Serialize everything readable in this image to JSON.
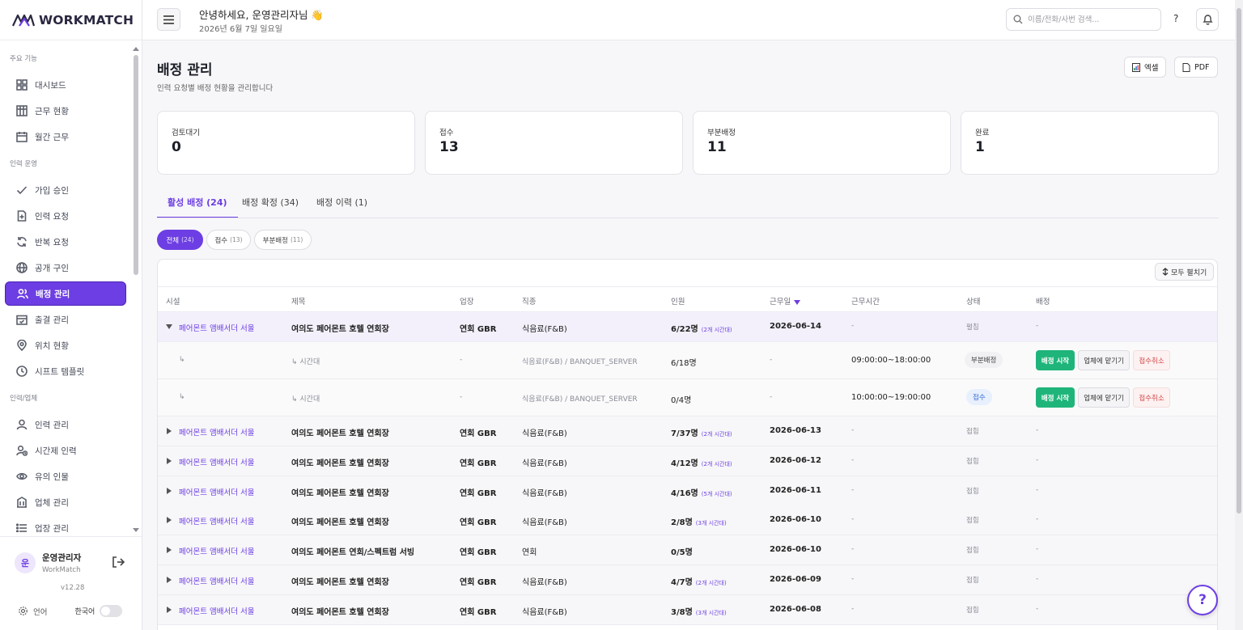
{
  "brand": {
    "name": "WORKMATCH",
    "accent": "#6d3ee3"
  },
  "sidebar": {
    "sections": [
      {
        "title": "주요 기능",
        "items": [
          {
            "label": "대시보드",
            "icon": "grid-icon"
          },
          {
            "label": "근무 현황",
            "icon": "table-icon"
          },
          {
            "label": "월간 근무",
            "icon": "calendar-icon"
          }
        ]
      },
      {
        "title": "인력 운영",
        "items": [
          {
            "label": "가입 승인",
            "icon": "check-icon"
          },
          {
            "label": "인력 요청",
            "icon": "file-plus-icon"
          },
          {
            "label": "반복 요청",
            "icon": "refresh-icon"
          },
          {
            "label": "공개 구인",
            "icon": "globe-icon"
          },
          {
            "label": "배정 관리",
            "icon": "users-icon",
            "active": true
          },
          {
            "label": "출결 관리",
            "icon": "calendar-check-icon"
          },
          {
            "label": "위치 현황",
            "icon": "map-pin-icon"
          },
          {
            "label": "시프트 템플릿",
            "icon": "clock-icon"
          }
        ]
      },
      {
        "title": "인력/업체",
        "items": [
          {
            "label": "인력 관리",
            "icon": "user-icon"
          },
          {
            "label": "시간제 인력",
            "icon": "user-clock-icon"
          },
          {
            "label": "유의 인물",
            "icon": "eye-icon"
          },
          {
            "label": "업체 관리",
            "icon": "building-icon"
          },
          {
            "label": "업장 관리",
            "icon": "list-icon"
          }
        ]
      }
    ],
    "user": {
      "initial": "운",
      "name": "운영관리자",
      "org": "WorkMatch"
    },
    "version": "v12.28",
    "language": {
      "label": "언어",
      "value": "한국어"
    }
  },
  "header": {
    "greeting": "안녕하세요, 운영관리자님 👋",
    "date": "2026년 6월 7일 일요일",
    "search_placeholder": "이름/전화/사번 검색...",
    "help": "?"
  },
  "page": {
    "title": "배정 관리",
    "subtitle": "인력 요청별 배정 현황을 관리합니다",
    "export_excel": "엑셀",
    "export_pdf": "PDF"
  },
  "stats": [
    {
      "label": "검토대기",
      "value": "0"
    },
    {
      "label": "접수",
      "value": "13"
    },
    {
      "label": "부분배정",
      "value": "11"
    },
    {
      "label": "완료",
      "value": "1"
    }
  ],
  "tabs": [
    {
      "label": "활성 배정 (24)",
      "active": true
    },
    {
      "label": "배정 확정 (34)"
    },
    {
      "label": "배정 이력 (1)"
    }
  ],
  "filters": [
    {
      "label": "전체",
      "count": "(24)",
      "active": true
    },
    {
      "label": "접수",
      "count": "(13)"
    },
    {
      "label": "부분배정",
      "count": "(11)"
    }
  ],
  "table": {
    "expand_all": "모두 펼치기",
    "columns": [
      "시설",
      "제목",
      "업장",
      "직종",
      "인원",
      "근무일",
      "근무시간",
      "상태",
      "배정"
    ],
    "open_row": {
      "facility": "페어몬트 앰배서더 서울",
      "title": "여의도 페어몬트 호텔 연회장",
      "venue": "연회 GBR",
      "job": "식음료(F&B)",
      "headcount": "6/22명",
      "segments": "(2개 시간대)",
      "date": "2026-06-14",
      "time": "-",
      "status": "펼침",
      "assign": "-",
      "subrows": [
        {
          "arrow": "↳",
          "title": "↳ 시간대",
          "venue": "-",
          "job": "식음료(F&B) / BANQUET_SERVER",
          "headcount": "6/18명",
          "date": "-",
          "time": "09:00:00~18:00:00",
          "status": "부분배정",
          "status_kind": "partial"
        },
        {
          "arrow": "↳",
          "title": "↳ 시간대",
          "venue": "-",
          "job": "식음료(F&B) / BANQUET_SERVER",
          "headcount": "0/4명",
          "date": "-",
          "time": "10:00:00~19:00:00",
          "status": "접수",
          "status_kind": "received"
        }
      ],
      "actions": {
        "start": "배정 시작",
        "vendor": "업체에 맡기기",
        "cancel": "접수취소"
      }
    },
    "rows": [
      {
        "facility": "페어몬트 앰배서더 서울",
        "title": "여의도 페어몬트 호텔 연회장",
        "venue": "연회 GBR",
        "job": "식음료(F&B)",
        "headcount": "7/37명",
        "segments": "(2개 시간대)",
        "date": "2026-06-13",
        "time": "-",
        "status": "접힘",
        "assign": "-"
      },
      {
        "facility": "페어몬트 앰배서더 서울",
        "title": "여의도 페어몬트 호텔 연회장",
        "venue": "연회 GBR",
        "job": "식음료(F&B)",
        "headcount": "4/12명",
        "segments": "(2개 시간대)",
        "date": "2026-06-12",
        "time": "-",
        "status": "접힘",
        "assign": "-"
      },
      {
        "facility": "페어몬트 앰배서더 서울",
        "title": "여의도 페어몬트 호텔 연회장",
        "venue": "연회 GBR",
        "job": "식음료(F&B)",
        "headcount": "4/16명",
        "segments": "(5개 시간대)",
        "date": "2026-06-11",
        "time": "-",
        "status": "접힘",
        "assign": "-"
      },
      {
        "facility": "페어몬트 앰배서더 서울",
        "title": "여의도 페어몬트 호텔 연회장",
        "venue": "연회 GBR",
        "job": "식음료(F&B)",
        "headcount": "2/8명",
        "segments": "(3개 시간대)",
        "date": "2026-06-10",
        "time": "-",
        "status": "접힘",
        "assign": "-"
      },
      {
        "facility": "페어몬트 앰배서더 서울",
        "title": "여의도 페어몬트 연회/스펙트럼 서빙",
        "venue": "연회 GBR",
        "job": "연회",
        "headcount": "0/5명",
        "segments": "",
        "date": "2026-06-10",
        "time": "-",
        "status": "접힘",
        "assign": "-"
      },
      {
        "facility": "페어몬트 앰배서더 서울",
        "title": "여의도 페어몬트 호텔 연회장",
        "venue": "연회 GBR",
        "job": "식음료(F&B)",
        "headcount": "4/7명",
        "segments": "(2개 시간대)",
        "date": "2026-06-09",
        "time": "-",
        "status": "접힘",
        "assign": "-"
      },
      {
        "facility": "페어몬트 앰배서더 서울",
        "title": "여의도 페어몬트 호텔 연회장",
        "venue": "연회 GBR",
        "job": "식음료(F&B)",
        "headcount": "3/8명",
        "segments": "(3개 시간대)",
        "date": "2026-06-08",
        "time": "-",
        "status": "접힘",
        "assign": "-"
      }
    ]
  },
  "fab": "?"
}
